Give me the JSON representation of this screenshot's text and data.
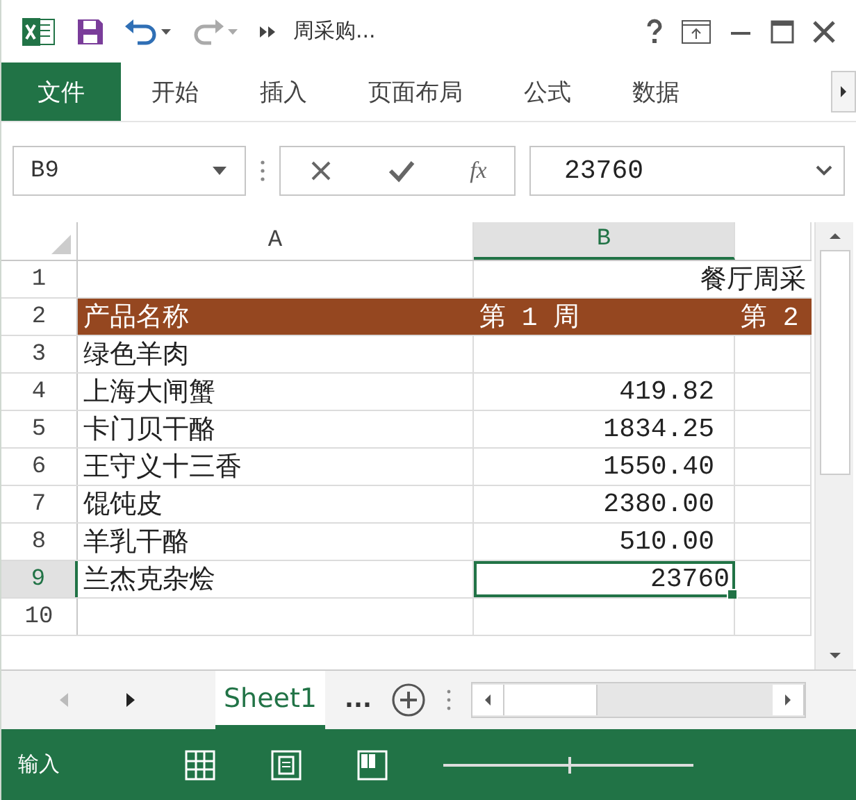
{
  "window": {
    "title": "周采购..."
  },
  "ribbon_tabs": [
    {
      "label": "文件",
      "selected": true
    },
    {
      "label": "开始",
      "selected": false
    },
    {
      "label": "插入",
      "selected": false
    },
    {
      "label": "页面布局",
      "selected": false
    },
    {
      "label": "公式",
      "selected": false
    },
    {
      "label": "数据",
      "selected": false
    }
  ],
  "name_box": {
    "value": "B9"
  },
  "formula_bar": {
    "function_label": "fx",
    "value": "23760"
  },
  "columns": [
    {
      "label": "A",
      "selected": false
    },
    {
      "label": "B",
      "selected": true
    }
  ],
  "rows": [
    {
      "number": "1",
      "kind": "title",
      "selected": false,
      "cells": [
        "餐厅周采"
      ]
    },
    {
      "number": "2",
      "kind": "header",
      "selected": false,
      "cells": [
        "产品名称",
        "第 1 周",
        "第 2"
      ]
    },
    {
      "number": "3",
      "kind": "data",
      "selected": false,
      "cells": [
        "绿色羊肉"
      ]
    },
    {
      "number": "4",
      "kind": "data",
      "selected": false,
      "cells": [
        "上海大闸蟹",
        "419.82"
      ]
    },
    {
      "number": "5",
      "kind": "data",
      "selected": false,
      "cells": [
        "卡门贝干酪",
        "1834.25"
      ]
    },
    {
      "number": "6",
      "kind": "data",
      "selected": false,
      "cells": [
        "王守义十三香",
        "1550.40"
      ]
    },
    {
      "number": "7",
      "kind": "data",
      "selected": false,
      "cells": [
        "馄饨皮",
        "2380.00"
      ]
    },
    {
      "number": "8",
      "kind": "data",
      "selected": false,
      "cells": [
        "羊乳干酪",
        "510.00"
      ]
    },
    {
      "number": "9",
      "kind": "data",
      "selected": true,
      "cells": [
        "兰杰克杂烩",
        "23760"
      ]
    },
    {
      "number": "10",
      "kind": "data",
      "selected": false,
      "cells": []
    }
  ],
  "sheet_tabs": [
    {
      "label": "Sheet1",
      "selected": true
    }
  ],
  "sheet_more": "...",
  "status_bar": {
    "mode": "输入"
  },
  "zoom_slider": {
    "level": 0.5
  }
}
